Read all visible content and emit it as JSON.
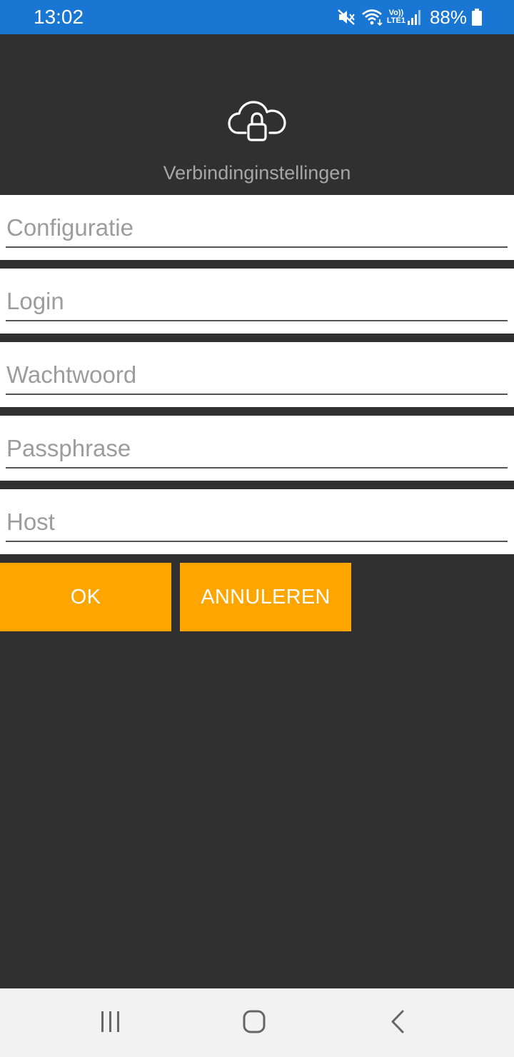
{
  "status_bar": {
    "time": "13:02",
    "volte_top": "Vo))",
    "volte_bottom": "LTE1",
    "battery_percent": "88%",
    "icons": [
      "mute-icon",
      "wifi-icon",
      "volte-icon",
      "signal-icon",
      "battery-icon"
    ]
  },
  "header": {
    "icon": "cloud-lock-icon",
    "title": "Verbindinginstellingen"
  },
  "form": {
    "fields": [
      {
        "placeholder": "Configuratie",
        "value": ""
      },
      {
        "placeholder": "Login",
        "value": ""
      },
      {
        "placeholder": "Wachtwoord",
        "value": ""
      },
      {
        "placeholder": "Passphrase",
        "value": ""
      },
      {
        "placeholder": "Host",
        "value": ""
      }
    ]
  },
  "buttons": {
    "ok_label": "OK",
    "cancel_label": "ANNULEREN"
  },
  "nav_bar": {
    "icons": [
      "recent-apps-icon",
      "home-icon",
      "back-icon"
    ]
  },
  "colors": {
    "status_bar": "#1976d2",
    "background": "#303030",
    "accent": "#ffa500",
    "field_background": "#ffffff",
    "placeholder": "#9c9c9c",
    "nav_bar": "#f2f2f2"
  }
}
